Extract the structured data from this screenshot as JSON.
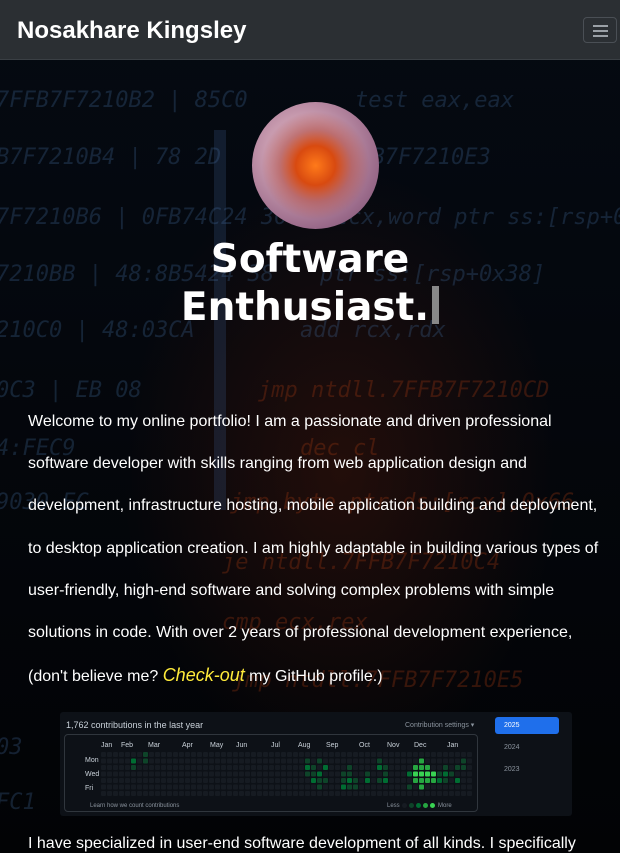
{
  "navbar": {
    "brand": "Nosakhare Kingsley",
    "toggle_icon": "hamburger-menu-icon"
  },
  "hero": {
    "headline_line1": "Software",
    "headline_line2": "Enthusiast."
  },
  "intro": {
    "text_before_link": "Welcome to my online portfolio! I am a passionate and driven professional software developer with skills ranging from web application design and development, infrastructure hosting, mobile application building and deployment, to desktop application creation. I am highly adaptable in building various types of user-friendly, high-end software and solving complex problems with simple solutions in code. With over 2 years of professional development experience, (don't believe me? ",
    "link_text": "Check-out",
    "text_after_link": " my GitHub profile.)"
  },
  "contributions": {
    "heading": "1,762 contributions in the last year",
    "settings_label": "Contribution settings ▾",
    "months": [
      "Jan",
      "Feb",
      "Mar",
      "Apr",
      "May",
      "Jun",
      "Jul",
      "Aug",
      "Sep",
      "Oct",
      "Nov",
      "Dec",
      "Jan"
    ],
    "days": [
      "Mon",
      "Wed",
      "Fri"
    ],
    "footer_link": "Learn how we count contributions",
    "legend_less": "Less",
    "legend_more": "More",
    "years": [
      "2025",
      "2024",
      "2023"
    ],
    "colors": {
      "empty": "#161b22",
      "l1": "#0e4429",
      "l2": "#006d32",
      "l3": "#26a641",
      "l4": "#39d353",
      "accent": "#1f6feb"
    }
  },
  "more_text": "I have specialized in user-end software development of all kinds. I specifically"
}
